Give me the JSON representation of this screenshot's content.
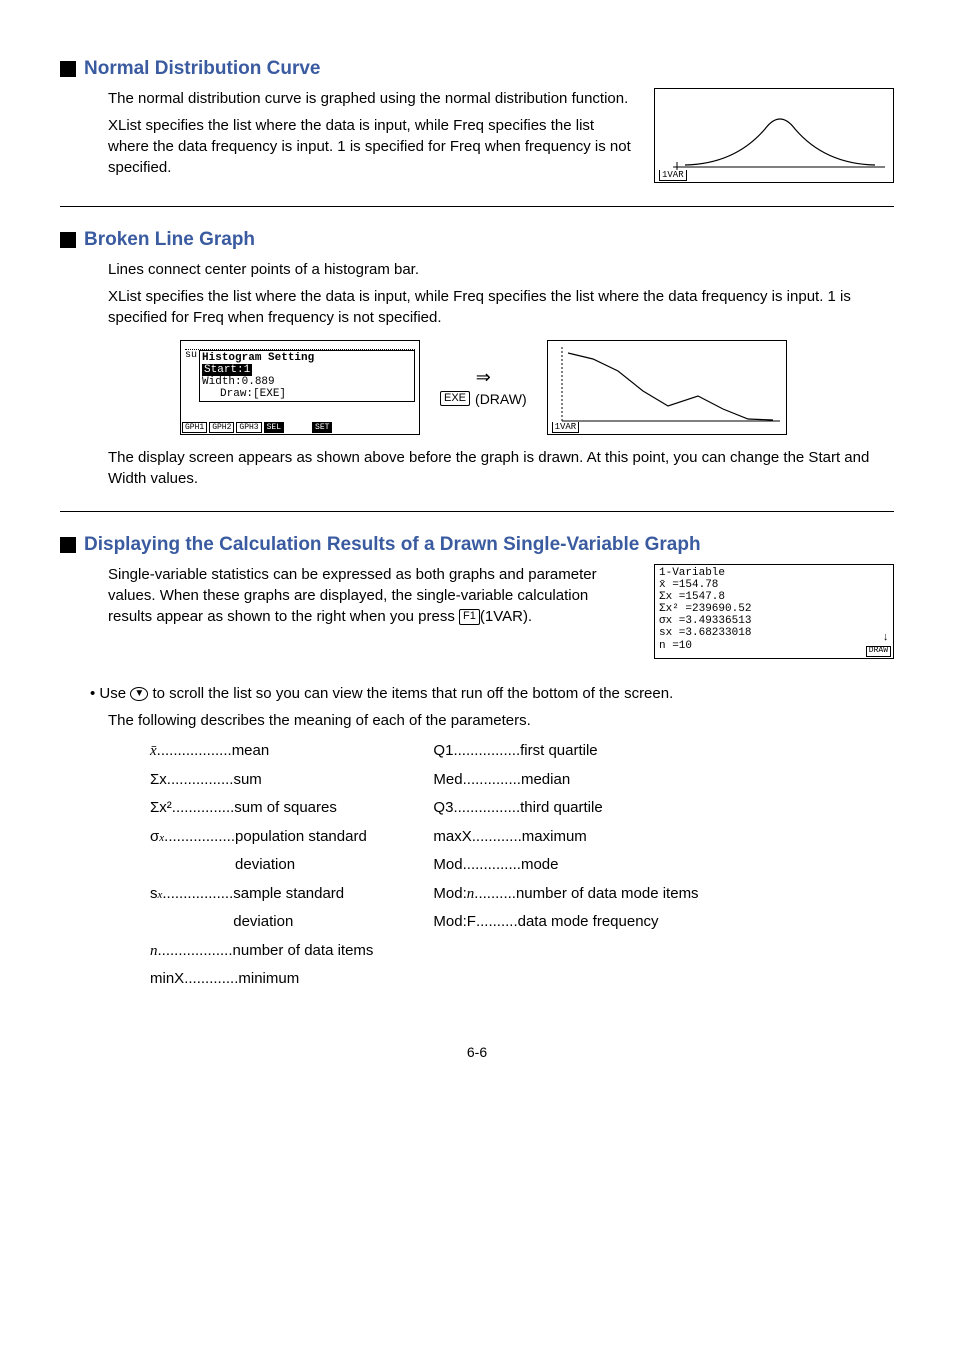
{
  "sections": {
    "normal": {
      "title": "Normal Distribution Curve",
      "p1": "The normal distribution curve is graphed using the normal distribution function.",
      "p2": "XList specifies the list where the data is input, while Freq specifies the list where the data frequency is input. 1 is specified for Freq when frequency is not specified.",
      "screen_label": "1VAR"
    },
    "broken": {
      "title": "Broken Line Graph",
      "p1": "Lines connect center points of a histogram bar.",
      "p2": "XList specifies the list where the data is input, while Freq specifies the list where the data frequency is input. 1 is specified for Freq when frequency is not specified.",
      "hist_title": "Histogram Setting",
      "hist_start": "Start:1",
      "hist_width": "Width:0.889",
      "hist_draw": "Draw:[EXE]",
      "softkeys": [
        "GPH1",
        "GPH2",
        "GPH3",
        "SEL",
        "",
        "SET"
      ],
      "arrow": "⇒",
      "arrow_key": "EXE",
      "arrow_label": "(DRAW)",
      "screen_label": "1VAR",
      "p3": "The display screen appears as shown above before the graph is drawn. At this point, you can change the Start and Width values."
    },
    "results": {
      "title": "Displaying the Calculation Results of a Drawn Single-Variable Graph",
      "p1_a": "Single-variable statistics can be expressed as both graphs and parameter values. When these graphs are displayed, the single-variable calculation results appear as shown to the right when you press ",
      "p1_key": "F1",
      "p1_b": "(1VAR).",
      "stats": {
        "title": "1-Variable",
        "rows": [
          "x̄     =154.78",
          "Σx    =1547.8",
          "Σx²   =239690.52",
          "σx    =3.49336513",
          "sx    =3.68233018",
          "n     =10"
        ],
        "draw_key": "DRAW"
      },
      "bullet_a": "• Use ",
      "bullet_b": " to scroll the list so you can view the items that run off the bottom of the screen.",
      "p2": "The following describes the meaning of each of the parameters.",
      "left_params": [
        {
          "sym": "x̄",
          "dots": " ..................",
          "desc": "mean",
          "italic": true
        },
        {
          "sym": "Σx",
          "dots": " ................",
          "desc": "sum"
        },
        {
          "sym": "Σx²",
          "dots": " ...............",
          "desc": "sum of squares"
        },
        {
          "sym": "σx",
          "dots": " .................",
          "desc": "population standard deviation",
          "sub": true
        },
        {
          "sym": "sx",
          "dots": " .................",
          "desc": "sample standard deviation",
          "sub": true
        },
        {
          "sym": "n",
          "dots": " ..................",
          "desc": "number of data items",
          "italic": true
        },
        {
          "sym": "minX",
          "dots": ".............",
          "desc": "minimum"
        }
      ],
      "right_params": [
        {
          "sym": "Q1",
          "dots": " ................",
          "desc": "first quartile"
        },
        {
          "sym": "Med",
          "dots": "..............",
          "desc": "median"
        },
        {
          "sym": "Q3",
          "dots": " ................",
          "desc": "third quartile"
        },
        {
          "sym": "maxX",
          "dots": "............",
          "desc": "maximum"
        },
        {
          "sym": "Mod",
          "dots": "..............",
          "desc": "mode"
        },
        {
          "sym": "Mod:n",
          "dots": " ..........",
          "desc": "number of data mode items",
          "italic_n": true
        },
        {
          "sym": "Mod:F",
          "dots": " ..........",
          "desc": "data mode frequency"
        }
      ]
    }
  },
  "page_num": "6-6"
}
